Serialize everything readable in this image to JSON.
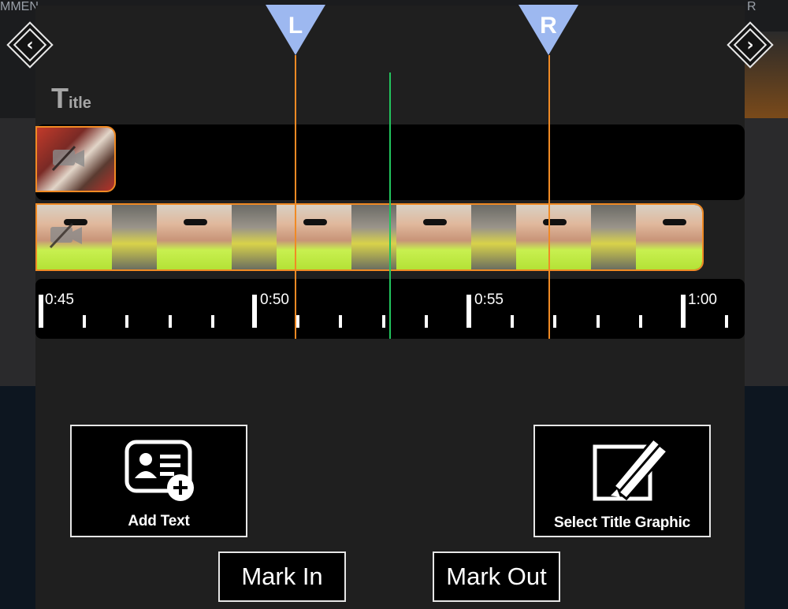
{
  "background": {
    "left_label": "MMEN",
    "right_label": "R"
  },
  "navigation": {
    "prev_icon": "chevron-left-icon",
    "next_icon": "chevron-right-icon",
    "prev_glyph": "‹",
    "next_glyph": "›"
  },
  "tracks": {
    "title_track_label_first": "T",
    "title_track_label_rest": "itle",
    "title_clip_icon": "video-camera-icon",
    "video_clip_icon": "video-camera-icon"
  },
  "markers": {
    "left_label": "L",
    "right_label": "R",
    "color": "#f08a24",
    "handle_color": "#9db8f0"
  },
  "playhead": {
    "color": "#22c55e"
  },
  "ruler": {
    "labels": [
      "0:45",
      "0:50",
      "0:55",
      "1:00"
    ]
  },
  "actions": {
    "add_text_label": "Add Text",
    "add_text_icon": "add-contact-card-icon",
    "select_title_graphic_label": "Select Title Graphic",
    "select_title_graphic_icon": "pen-brush-frame-icon",
    "mark_in_label": "Mark In",
    "mark_out_label": "Mark Out"
  }
}
